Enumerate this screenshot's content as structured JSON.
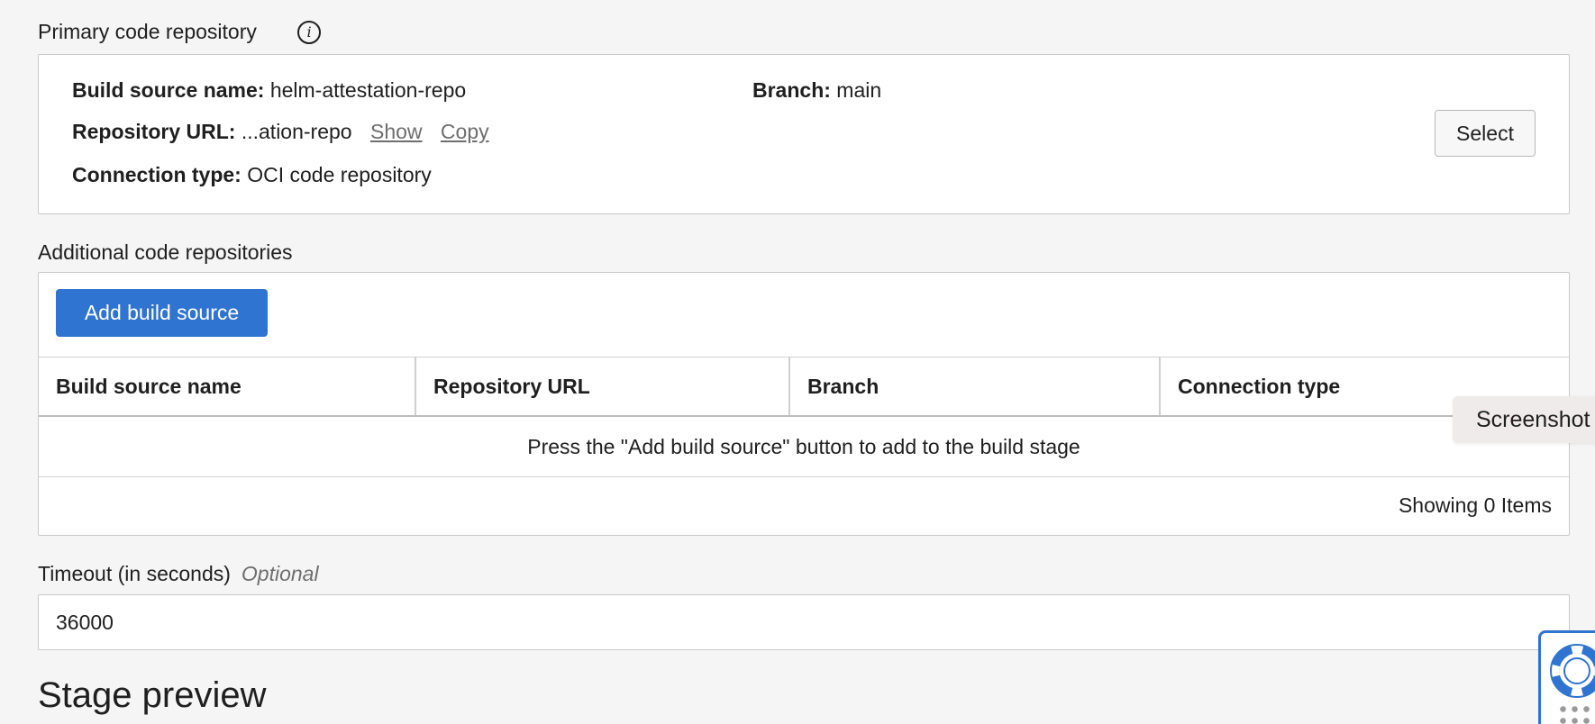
{
  "primary": {
    "label": "Primary code repository",
    "build_source_name_label": "Build source name:",
    "build_source_name": "helm-attestation-repo",
    "branch_label": "Branch:",
    "branch": "main",
    "repo_url_label": "Repository URL:",
    "repo_url": "...ation-repo",
    "show_label": "Show",
    "copy_label": "Copy",
    "connection_type_label": "Connection type:",
    "connection_type": "OCI code repository",
    "select_label": "Select"
  },
  "additional": {
    "label": "Additional code repositories",
    "add_button_label": "Add build source",
    "columns": [
      "Build source name",
      "Repository URL",
      "Branch",
      "Connection type"
    ],
    "empty_message": "Press the \"Add build source\" button to add to the build stage",
    "footer": "Showing 0 Items"
  },
  "timeout": {
    "label": "Timeout (in seconds)",
    "optional_label": "Optional",
    "value": "36000"
  },
  "stage_preview": {
    "title": "Stage preview"
  },
  "tooltip": {
    "text": "Screenshot"
  },
  "help_widget": {
    "icon": "lifebuoy-icon"
  },
  "colors": {
    "primary_button": "#2f74d0",
    "panel_border": "#c9c9c9",
    "background": "#f5f5f5"
  }
}
